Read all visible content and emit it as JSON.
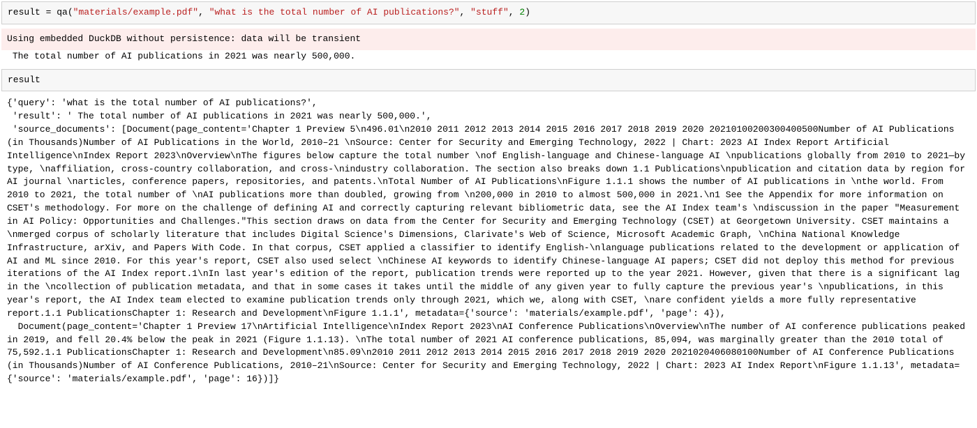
{
  "cell1": {
    "code": {
      "lhs": "result",
      "eq": " = ",
      "fn": "qa",
      "lp": "(",
      "arg1": "\"materials/example.pdf\"",
      "c1": ", ",
      "arg2": "\"what is the total number of AI publications?\"",
      "c2": ", ",
      "arg3": "\"stuff\"",
      "c3": ", ",
      "arg4": "2",
      "rp": ")"
    },
    "warn": "Using embedded DuckDB without persistence: data will be transient",
    "stdout": " The total number of AI publications in 2021 was nearly 500,000."
  },
  "cell2": {
    "code": "result",
    "output": "{'query': 'what is the total number of AI publications?',\n 'result': ' The total number of AI publications in 2021 was nearly 500,000.',\n 'source_documents': [Document(page_content='Chapter 1 Preview 5\\n496.01\\n2010 2011 2012 2013 2014 2015 2016 2017 2018 2019 2020 20210100200300400500Number of AI Publications (in Thousands)Number of AI Publications in the World, 2010–21 \\nSource: Center for Security and Emerging Technology, 2022 | Chart: 2023 AI Index Report Artificial Intelligence\\nIndex Report 2023\\nOverview\\nThe figures below capture the total number \\nof English-language and Chinese-language AI \\npublications globally from 2010 to 2021—by type, \\naffiliation, cross-country collaboration, and cross-\\nindustry collaboration. The section also breaks down 1.1 Publications\\npublication and citation data by region for AI journal \\narticles, conference papers, repositories, and patents.\\nTotal Number of AI Publications\\nFigure 1.1.1 shows the number of AI publications in \\nthe world. From 2010 to 2021, the total number of \\nAI publications more than doubled, growing from \\n200,000 in 2010 to almost 500,000 in 2021.\\n1 See the Appendix for more information on CSET's methodology. For more on the challenge of defining AI and correctly capturing relevant bibliometric data, see the AI Index team's \\ndiscussion in the paper \"Measurement in AI Policy: Opportunities and Challenges.\"This section draws on data from the Center for Security and Emerging Technology (CSET) at Georgetown University. CSET maintains a \\nmerged corpus of scholarly literature that includes Digital Science's Dimensions, Clarivate's Web of Science, Microsoft Academic Graph, \\nChina National Knowledge Infrastructure, arXiv, and Papers With Code. In that corpus, CSET applied a classifier to identify English-\\nlanguage publications related to the development or application of AI and ML since 2010. For this year's report, CSET also used select \\nChinese AI keywords to identify Chinese-language AI papers; CSET did not deploy this method for previous iterations of the AI Index report.1\\nIn last year's edition of the report, publication trends were reported up to the year 2021. However, given that there is a significant lag in the \\ncollection of publication metadata, and that in some cases it takes until the middle of any given year to fully capture the previous year's \\npublications, in this year's report, the AI Index team elected to examine publication trends only through 2021, which we, along with CSET, \\nare confident yields a more fully representative report.1.1 PublicationsChapter 1: Research and Development\\nFigure 1.1.1', metadata={'source': 'materials/example.pdf', 'page': 4}),\n  Document(page_content='Chapter 1 Preview 17\\nArtificial Intelligence\\nIndex Report 2023\\nAI Conference Publications\\nOverview\\nThe number of AI conference publications peaked in 2019, and fell 20.4% below the peak in 2021 (Figure 1.1.13). \\nThe total number of 2021 AI conference publications, 85,094, was marginally greater than the 2010 total of 75,592.1.1 PublicationsChapter 1: Research and Development\\n85.09\\n2010 2011 2012 2013 2014 2015 2016 2017 2018 2019 2020 2021020406080100Number of AI Conference Publications (in Thousands)Number of AI Conference Publications, 2010–21\\nSource: Center for Security and Emerging Technology, 2022 | Chart: 2023 AI Index Report\\nFigure 1.1.13', metadata={'source': 'materials/example.pdf', 'page': 16})]}"
  }
}
